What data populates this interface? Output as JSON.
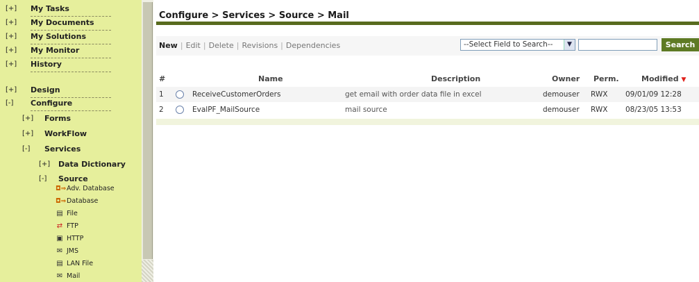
{
  "sidebar": {
    "top_items": [
      {
        "toggle": "[+]",
        "label": "My Tasks"
      },
      {
        "toggle": "[+]",
        "label": "My Documents"
      },
      {
        "toggle": "[+]",
        "label": "My Solutions"
      },
      {
        "toggle": "[+]",
        "label": "My Monitor"
      },
      {
        "toggle": "[+]",
        "label": "History"
      }
    ],
    "design": {
      "toggle": "[+]",
      "label": "Design"
    },
    "configure": {
      "toggle": "[-]",
      "label": "Configure"
    },
    "forms": {
      "toggle": "[+]",
      "label": "Forms"
    },
    "workflow": {
      "toggle": "[+]",
      "label": "WorkFlow"
    },
    "services": {
      "toggle": "[-]",
      "label": "Services"
    },
    "data_dictionary": {
      "toggle": "[+]",
      "label": "Data Dictionary"
    },
    "source": {
      "toggle": "[-]",
      "label": "Source"
    },
    "leaves": [
      {
        "icon": "adv-database-icon",
        "glyph": "◘⇒",
        "label": "Adv. Database"
      },
      {
        "icon": "database-icon",
        "glyph": "◘⇒",
        "label": "Database"
      },
      {
        "icon": "file-icon",
        "glyph": "▤",
        "label": "File"
      },
      {
        "icon": "ftp-icon",
        "glyph": "⇄",
        "label": "FTP"
      },
      {
        "icon": "http-icon",
        "glyph": "▣",
        "label": "HTTP"
      },
      {
        "icon": "jms-icon",
        "glyph": "✉",
        "label": "JMS"
      },
      {
        "icon": "lan-file-icon",
        "glyph": "▤",
        "label": "LAN File"
      },
      {
        "icon": "mail-icon",
        "glyph": "✉",
        "label": "Mail"
      }
    ]
  },
  "header": {
    "breadcrumb": "Configure > Services > Source > Mail"
  },
  "toolbar": {
    "actions": [
      "New",
      "Edit",
      "Delete",
      "Revisions",
      "Dependencies"
    ],
    "field_select": "--Select Field to Search--",
    "search_value": "",
    "search_label": "Search"
  },
  "table": {
    "headers": {
      "num": "#",
      "name": "Name",
      "description": "Description",
      "owner": "Owner",
      "perm": "Perm.",
      "modified": "Modified"
    },
    "sort_indicator": "▼",
    "rows": [
      {
        "num": "1",
        "name": "ReceiveCustomerOrders",
        "description": "get email with order data file in excel",
        "owner": "demouser",
        "perm": "RWX",
        "modified": "09/01/09 12:28"
      },
      {
        "num": "2",
        "name": "EvalPF_MailSource",
        "description": "mail source",
        "owner": "demouser",
        "perm": "RWX",
        "modified": "08/23/05 13:53"
      }
    ]
  },
  "colors": {
    "sidebar_bg": "#e6ef9c",
    "accent": "#586b1e",
    "search_button": "#5e7a24",
    "sort_arrow": "#e0201a"
  }
}
